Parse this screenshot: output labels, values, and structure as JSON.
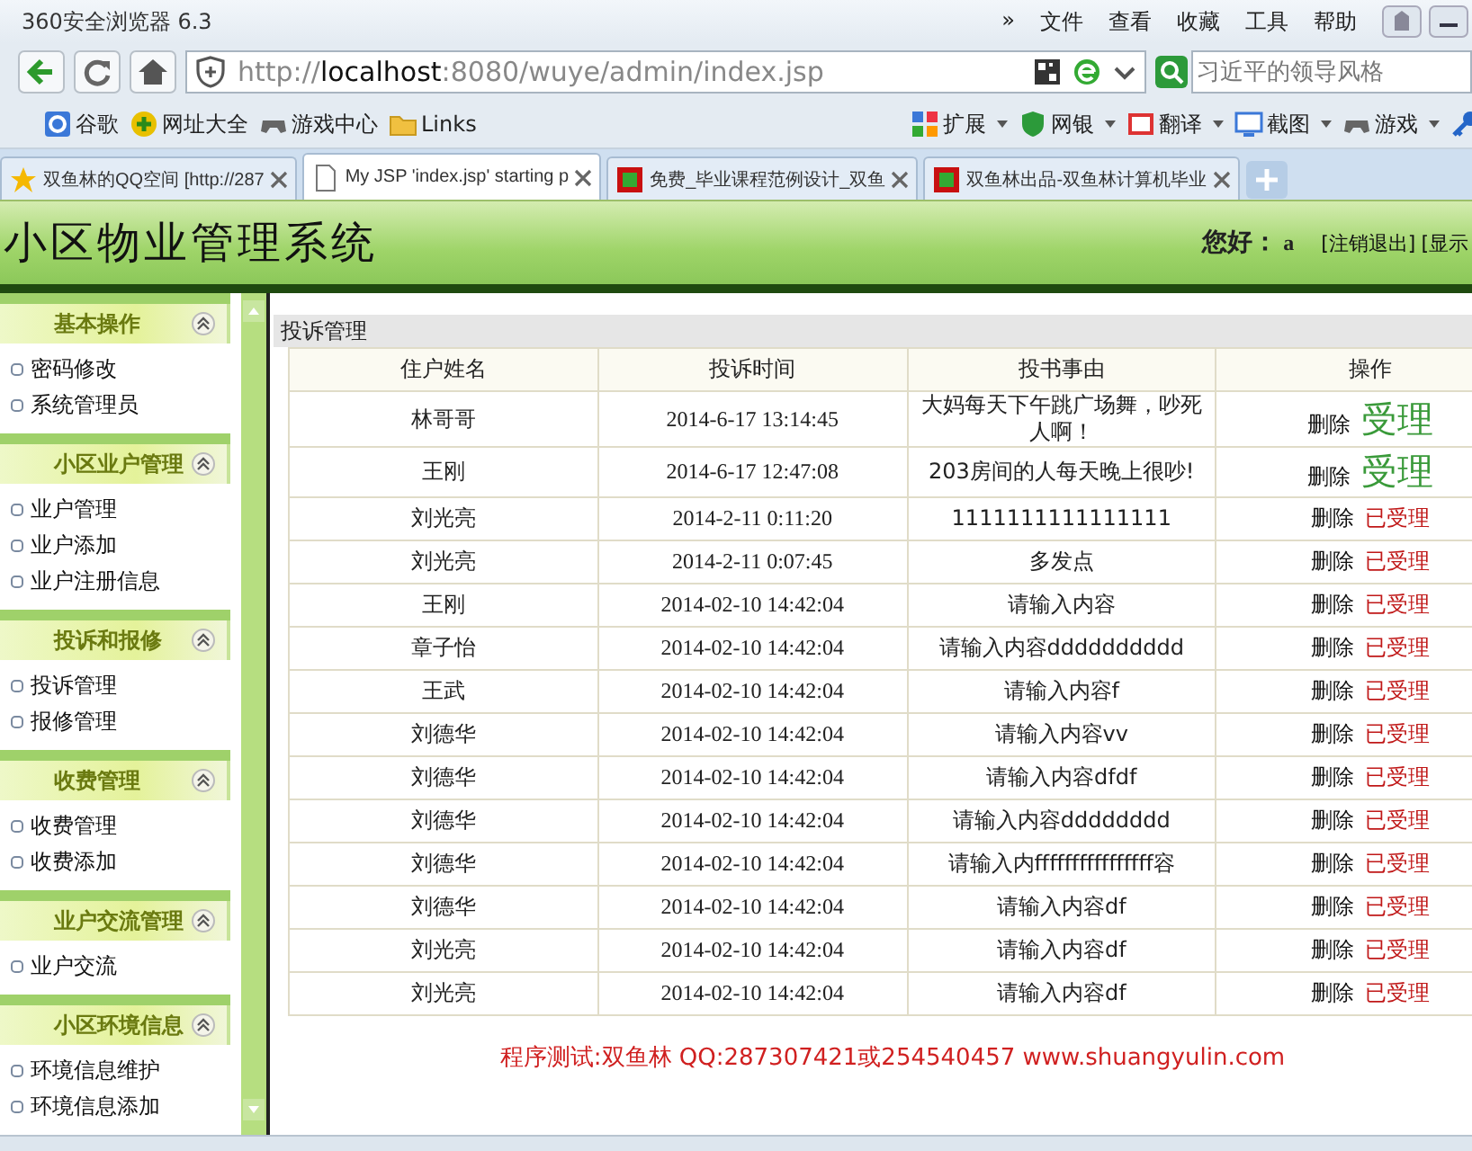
{
  "window": {
    "title": "360安全浏览器 6.3",
    "menu": [
      "»",
      "文件",
      "查看",
      "收藏",
      "工具",
      "帮助"
    ]
  },
  "address_bar": {
    "url": "http://**localhost**:8080/wuye/admin/index.jsp",
    "search": {
      "placeholder": "习近平的领导风格"
    }
  },
  "bookmarks": {
    "left": [
      {
        "label": "谷歌",
        "kind": "google"
      },
      {
        "label": "网址大全",
        "kind": "plus"
      },
      {
        "label": "游戏中心",
        "kind": "game"
      },
      {
        "label": "Links",
        "kind": "folder"
      }
    ],
    "right": [
      {
        "label": "扩展",
        "kind": "grid"
      },
      {
        "label": "网银",
        "kind": "bank"
      },
      {
        "label": "翻译",
        "kind": "dict"
      },
      {
        "label": "截图",
        "kind": "shot"
      },
      {
        "label": "游戏",
        "kind": "game"
      }
    ]
  },
  "tabs": [
    {
      "label": "双鱼林的QQ空间 [http://287",
      "selected": false,
      "kind": "star"
    },
    {
      "label": "My JSP 'index.jsp' starting p",
      "selected": true,
      "kind": "page"
    },
    {
      "label": "免费_毕业课程范例设计_双鱼",
      "selected": false,
      "kind": "red"
    },
    {
      "label": "双鱼林出品-双鱼林计算机毕业",
      "selected": false,
      "kind": "red"
    }
  ],
  "header": {
    "title": "小区物业管理系统",
    "greeting": "您好：",
    "user": "a",
    "links": [
      "[注销退出]",
      "[显示"
    ]
  },
  "sidebar": {
    "groups": [
      {
        "title": "基本操作",
        "items": [
          "密码修改",
          "系统管理员"
        ]
      },
      {
        "title": "小区业户管理",
        "items": [
          "业户管理",
          "业户添加",
          "业户注册信息"
        ]
      },
      {
        "title": "投诉和报修",
        "items": [
          "投诉管理",
          "报修管理"
        ]
      },
      {
        "title": "收费管理",
        "items": [
          "收费管理",
          "收费添加"
        ]
      },
      {
        "title": "业户交流管理",
        "items": [
          "业户交流"
        ]
      },
      {
        "title": "小区环境信息",
        "items": [
          "环境信息维护",
          "环境信息添加"
        ]
      }
    ]
  },
  "panel": {
    "title": "投诉管理",
    "columns": [
      "住户姓名",
      "投诉时间",
      "投书事由",
      "操作"
    ],
    "rows": [
      {
        "name": "林哥哥",
        "time": "2014-6-17 13:14:45",
        "reason": "大妈每天下午跳广场舞，吵死人啊！",
        "delete": "删除",
        "action": {
          "label": "受理",
          "kind": "pending"
        }
      },
      {
        "name": "王刚",
        "time": "2014-6-17 12:47:08",
        "reason": "203房间的人每天晚上很吵!",
        "delete": "删除",
        "action": {
          "label": "受理",
          "kind": "pending"
        }
      },
      {
        "name": "刘光亮",
        "time": "2014-2-11 0:11:20",
        "reason": "1111111111111111",
        "delete": "删除",
        "action": {
          "label": "已受理",
          "kind": "done"
        }
      },
      {
        "name": "刘光亮",
        "time": "2014-2-11 0:07:45",
        "reason": "多发点",
        "delete": "删除",
        "action": {
          "label": "已受理",
          "kind": "done"
        }
      },
      {
        "name": "王刚",
        "time": "2014-02-10 14:42:04",
        "reason": "请输入内容",
        "delete": "删除",
        "action": {
          "label": "已受理",
          "kind": "done"
        }
      },
      {
        "name": "章子怡",
        "time": "2014-02-10 14:42:04",
        "reason": "请输入内容dddddddddd",
        "delete": "删除",
        "action": {
          "label": "已受理",
          "kind": "done"
        }
      },
      {
        "name": "王武",
        "time": "2014-02-10 14:42:04",
        "reason": "请输入内容f",
        "delete": "删除",
        "action": {
          "label": "已受理",
          "kind": "done"
        }
      },
      {
        "name": "刘德华",
        "time": "2014-02-10 14:42:04",
        "reason": "请输入内容vv",
        "delete": "删除",
        "action": {
          "label": "已受理",
          "kind": "done"
        }
      },
      {
        "name": "刘德华",
        "time": "2014-02-10 14:42:04",
        "reason": "请输入内容dfdf",
        "delete": "删除",
        "action": {
          "label": "已受理",
          "kind": "done"
        }
      },
      {
        "name": "刘德华",
        "time": "2014-02-10 14:42:04",
        "reason": "请输入内容dddddddd",
        "delete": "删除",
        "action": {
          "label": "已受理",
          "kind": "done"
        }
      },
      {
        "name": "刘德华",
        "time": "2014-02-10 14:42:04",
        "reason": "请输入内ffffffffffffffff容",
        "delete": "删除",
        "action": {
          "label": "已受理",
          "kind": "done"
        }
      },
      {
        "name": "刘德华",
        "time": "2014-02-10 14:42:04",
        "reason": "请输入内容df",
        "delete": "删除",
        "action": {
          "label": "已受理",
          "kind": "done"
        }
      },
      {
        "name": "刘光亮",
        "time": "2014-02-10 14:42:04",
        "reason": "请输入内容df",
        "delete": "删除",
        "action": {
          "label": "已受理",
          "kind": "done"
        }
      },
      {
        "name": "刘光亮",
        "time": "2014-02-10 14:42:04",
        "reason": "请输入内容df",
        "delete": "删除",
        "action": {
          "label": "已受理",
          "kind": "done"
        }
      }
    ],
    "footer": "程序测试:双鱼林 QQ:287307421或254540457 www.shuangyulin.com"
  }
}
